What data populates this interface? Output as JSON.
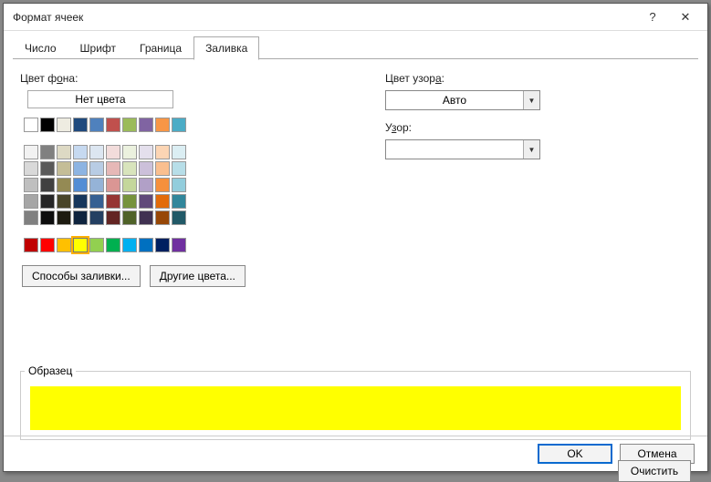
{
  "title": "Формат ячеек",
  "help_glyph": "?",
  "close_glyph": "✕",
  "tabs": {
    "t0": "Число",
    "t1": "Шрифт",
    "t2": "Граница",
    "t3": "Заливка"
  },
  "labels": {
    "bgcolor_before": "Цвет ф",
    "bgcolor_u": "о",
    "bgcolor_after": "на:",
    "patcolor_before": "Цвет узор",
    "patcolor_u": "а",
    "patcolor_after": ":",
    "pattern_before": "У",
    "pattern_u": "з",
    "pattern_after": "ор:",
    "no_color": "Нет цвета",
    "fill_effects": "Способы заливки...",
    "more_colors": "Другие цвета...",
    "sample": "Образец",
    "clear": "Очистить",
    "ok": "OK",
    "cancel": "Отмена",
    "pattern_color_value": "Авто",
    "pattern_value": ""
  },
  "palette": {
    "theme_row": [
      "#ffffff",
      "#000000",
      "#eeece1",
      "#1f497d",
      "#4f81bd",
      "#c0504d",
      "#9bbb59",
      "#8064a2",
      "#f79646",
      "#4bacc6"
    ],
    "shade_row": [
      "#ffffff",
      "#000000",
      "#f2f2f2",
      "#d9d9d9",
      "#bfbfbf",
      "#a6a6a6",
      "#808080",
      "#595959",
      "#404040",
      "#262626"
    ],
    "shade_grid": [
      [
        "#f2f2f2",
        "#808080",
        "#ddd9c4",
        "#c6d9f0",
        "#dce6f1",
        "#f2dcdb",
        "#ebf1de",
        "#e4dfec",
        "#fcd5b4",
        "#dbeef3"
      ],
      [
        "#d9d9d9",
        "#595959",
        "#c4bd97",
        "#8db4e2",
        "#b8cce4",
        "#e6b8b7",
        "#d8e4bc",
        "#ccc0da",
        "#fabf8f",
        "#b7dee8"
      ],
      [
        "#bfbfbf",
        "#404040",
        "#948a54",
        "#538dd5",
        "#95b3d7",
        "#da9694",
        "#c4d79b",
        "#b1a0c7",
        "#f6903c",
        "#92cddc"
      ],
      [
        "#a6a6a6",
        "#262626",
        "#494529",
        "#16365c",
        "#366092",
        "#963634",
        "#76933c",
        "#60497a",
        "#e26b0a",
        "#31869b"
      ],
      [
        "#808080",
        "#0d0d0d",
        "#1d1b10",
        "#0f243e",
        "#244062",
        "#632523",
        "#4f6228",
        "#403151",
        "#974706",
        "#215967"
      ]
    ],
    "standard_row": [
      "#c00000",
      "#ff0000",
      "#ffc000",
      "#ffff00",
      "#92d050",
      "#00b050",
      "#00b0f0",
      "#0070c0",
      "#002060",
      "#7030a0"
    ]
  },
  "selected_color": "#ffff00"
}
